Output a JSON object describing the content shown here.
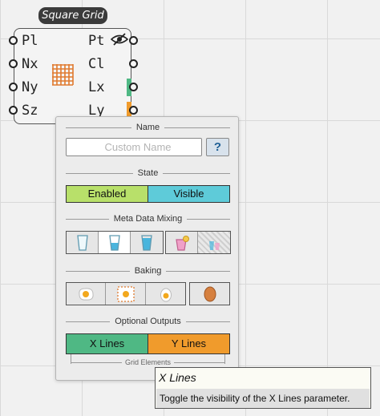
{
  "component": {
    "title": "Square Grid",
    "inputs": [
      "Pl",
      "Nx",
      "Ny",
      "Sz"
    ],
    "outputs": [
      "Pt",
      "Cl",
      "Lx",
      "Ly"
    ],
    "icon": "square-grid-icon",
    "preview_icon": "eye-hidden-icon",
    "colors": {
      "x_lines": "#4fb884",
      "y_lines": "#f09b2c",
      "grid_icon": "#e07a2e"
    }
  },
  "panel": {
    "name_section": {
      "title": "Name",
      "placeholder": "Custom Name",
      "help_label": "?"
    },
    "state_section": {
      "title": "State",
      "enabled_label": "Enabled",
      "visible_label": "Visible",
      "colors": {
        "enabled": "#b8e06a",
        "visible": "#5ecbd9"
      }
    },
    "meta_section": {
      "title": "Meta Data Mixing",
      "icons": [
        "glass-empty-icon",
        "glass-half-icon",
        "glass-full-icon",
        "glass-cocktail-icon",
        "glass-mixed-icon"
      ],
      "active_index": 1
    },
    "baking_section": {
      "title": "Baking",
      "icons": [
        "fried-egg-icon",
        "egg-in-box-icon",
        "boiled-egg-icon",
        "whole-egg-icon"
      ]
    },
    "optional_outputs": {
      "title": "Optional Outputs",
      "x_lines_label": "X Lines",
      "y_lines_label": "Y Lines",
      "group_label": "Grid Elements"
    }
  },
  "tooltip": {
    "title": "X Lines",
    "body": "Toggle the visibility of the X Lines parameter."
  }
}
